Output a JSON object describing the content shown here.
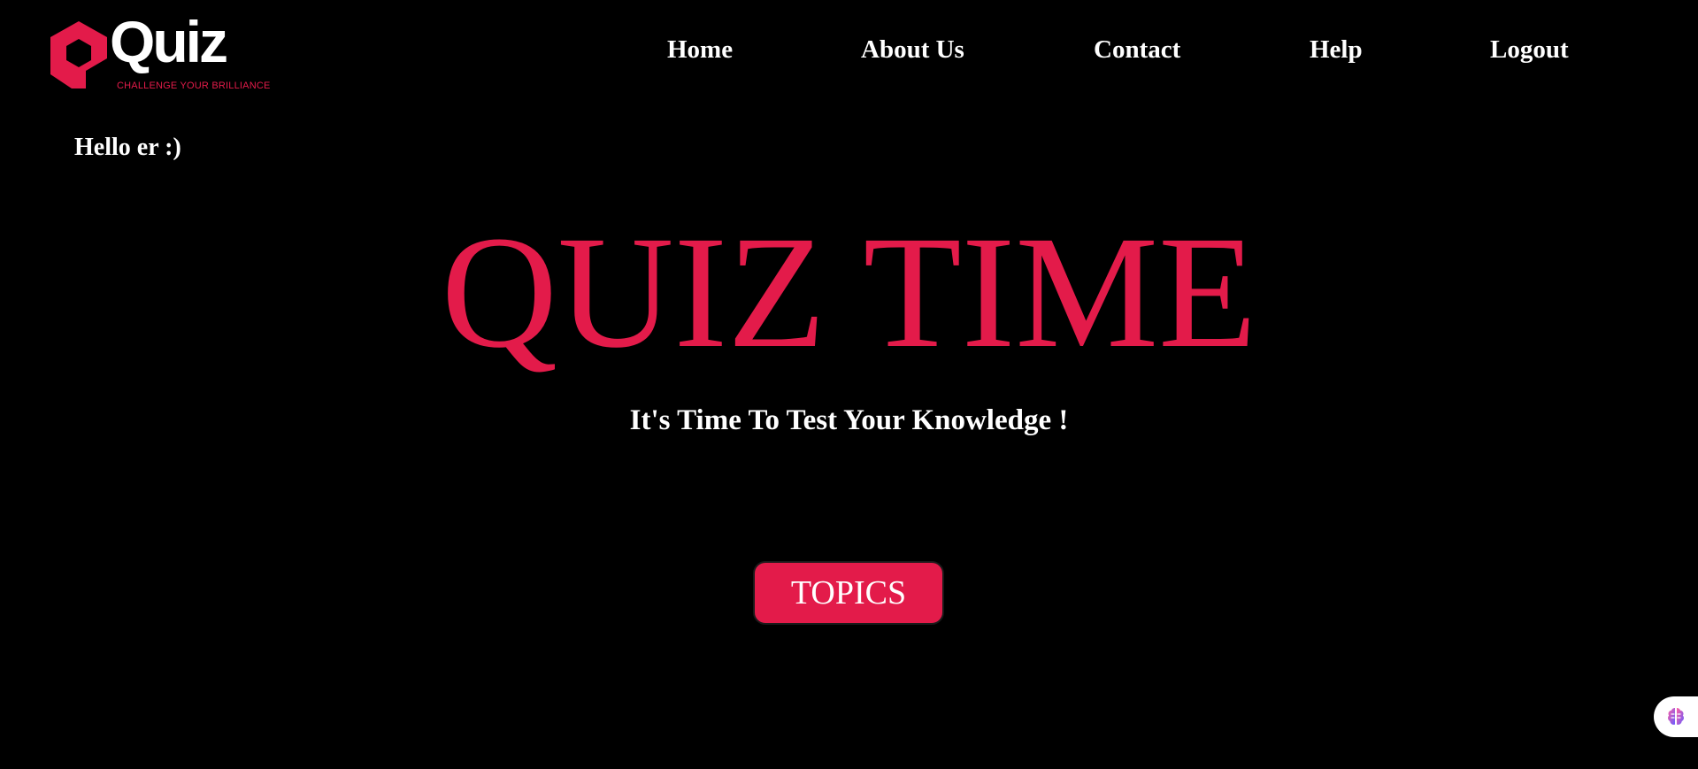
{
  "logo": {
    "wordmark": "Quiz",
    "tagline": "CHALLENGE YOUR BRILLIANCE"
  },
  "nav": {
    "items": [
      {
        "label": "Home"
      },
      {
        "label": "About Us"
      },
      {
        "label": "Contact"
      },
      {
        "label": "Help"
      },
      {
        "label": "Logout"
      }
    ]
  },
  "greeting": "Hello er :)",
  "hero": {
    "title": "QUIZ TIME",
    "subtitle": "It's Time To Test Your Knowledge !"
  },
  "topics_button": {
    "label": "TOPICS"
  },
  "assistant": {
    "icon": "brain-icon"
  },
  "colors": {
    "background": "#000000",
    "accent": "#e31b4a",
    "text": "#ffffff"
  }
}
